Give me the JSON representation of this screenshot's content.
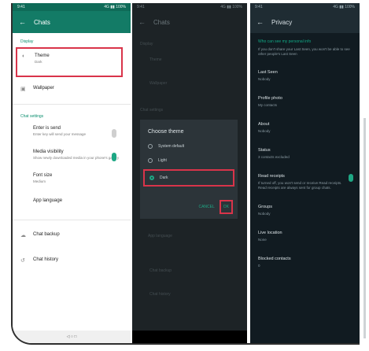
{
  "p1": {
    "status_left": "9:41",
    "status_right": "4G ▮▮ 100%",
    "title": "Chats",
    "section_display": "Display",
    "theme": {
      "label": "Theme",
      "value": "Dark"
    },
    "wallpaper": "Wallpaper",
    "section_settings": "Chat settings",
    "enter_send": {
      "label": "Enter is send",
      "desc": "Enter key will send your message"
    },
    "media_visibility": {
      "label": "Media visibility",
      "desc": "Show newly downloaded media in your phone's gallery"
    },
    "font_size": {
      "label": "Font size",
      "value": "Medium"
    },
    "app_language": "App language",
    "chat_backup": "Chat backup",
    "chat_history": "Chat history",
    "nav": "◁   ○   □"
  },
  "p2": {
    "status_left": "9:41",
    "status_right": "4G ▮▮ 100%",
    "title": "Chats",
    "dim_rows": [
      "Display",
      "Theme",
      "Wallpaper",
      "Chat settings",
      "App language",
      "Chat backup",
      "Chat history"
    ],
    "dialog": {
      "title": "Choose theme",
      "options": [
        "System default",
        "Light",
        "Dark"
      ],
      "cancel": "CANCEL",
      "ok": "OK"
    }
  },
  "p3": {
    "status_left": "9:41",
    "status_right": "4G ▮▮ 100%",
    "title": "Privacy",
    "section": "Who can see my personal info",
    "note": "If you don't share your Last Seen, you won't be able to see other people's Last Seen",
    "items": [
      {
        "label": "Last Seen",
        "value": "Nobody"
      },
      {
        "label": "Profile photo",
        "value": "My contacts"
      },
      {
        "label": "About",
        "value": "Nobody"
      },
      {
        "label": "Status",
        "value": "3 contacts excluded"
      },
      {
        "label": "Read receipts",
        "value": "If turned off, you won't send or receive Read receipts. Read receipts are always sent for group chats."
      },
      {
        "label": "Groups",
        "value": "Nobody"
      },
      {
        "label": "Live location",
        "value": "None"
      },
      {
        "label": "Blocked contacts",
        "value": "0"
      }
    ]
  }
}
